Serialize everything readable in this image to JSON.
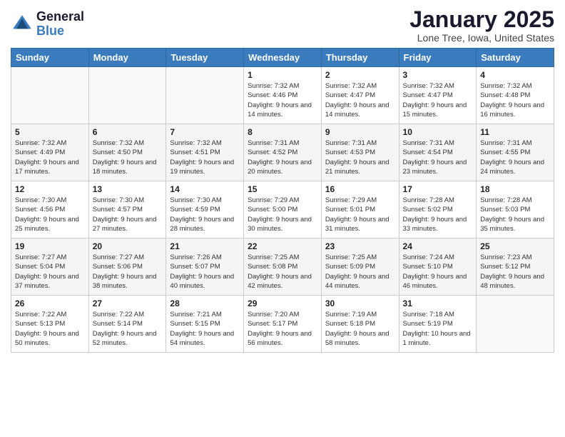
{
  "header": {
    "logo_general": "General",
    "logo_blue": "Blue",
    "month_title": "January 2025",
    "location": "Lone Tree, Iowa, United States"
  },
  "days_of_week": [
    "Sunday",
    "Monday",
    "Tuesday",
    "Wednesday",
    "Thursday",
    "Friday",
    "Saturday"
  ],
  "weeks": [
    [
      {
        "day": "",
        "sunrise": "",
        "sunset": "",
        "daylight": ""
      },
      {
        "day": "",
        "sunrise": "",
        "sunset": "",
        "daylight": ""
      },
      {
        "day": "",
        "sunrise": "",
        "sunset": "",
        "daylight": ""
      },
      {
        "day": "1",
        "sunrise": "Sunrise: 7:32 AM",
        "sunset": "Sunset: 4:46 PM",
        "daylight": "Daylight: 9 hours and 14 minutes."
      },
      {
        "day": "2",
        "sunrise": "Sunrise: 7:32 AM",
        "sunset": "Sunset: 4:47 PM",
        "daylight": "Daylight: 9 hours and 14 minutes."
      },
      {
        "day": "3",
        "sunrise": "Sunrise: 7:32 AM",
        "sunset": "Sunset: 4:47 PM",
        "daylight": "Daylight: 9 hours and 15 minutes."
      },
      {
        "day": "4",
        "sunrise": "Sunrise: 7:32 AM",
        "sunset": "Sunset: 4:48 PM",
        "daylight": "Daylight: 9 hours and 16 minutes."
      }
    ],
    [
      {
        "day": "5",
        "sunrise": "Sunrise: 7:32 AM",
        "sunset": "Sunset: 4:49 PM",
        "daylight": "Daylight: 9 hours and 17 minutes."
      },
      {
        "day": "6",
        "sunrise": "Sunrise: 7:32 AM",
        "sunset": "Sunset: 4:50 PM",
        "daylight": "Daylight: 9 hours and 18 minutes."
      },
      {
        "day": "7",
        "sunrise": "Sunrise: 7:32 AM",
        "sunset": "Sunset: 4:51 PM",
        "daylight": "Daylight: 9 hours and 19 minutes."
      },
      {
        "day": "8",
        "sunrise": "Sunrise: 7:31 AM",
        "sunset": "Sunset: 4:52 PM",
        "daylight": "Daylight: 9 hours and 20 minutes."
      },
      {
        "day": "9",
        "sunrise": "Sunrise: 7:31 AM",
        "sunset": "Sunset: 4:53 PM",
        "daylight": "Daylight: 9 hours and 21 minutes."
      },
      {
        "day": "10",
        "sunrise": "Sunrise: 7:31 AM",
        "sunset": "Sunset: 4:54 PM",
        "daylight": "Daylight: 9 hours and 23 minutes."
      },
      {
        "day": "11",
        "sunrise": "Sunrise: 7:31 AM",
        "sunset": "Sunset: 4:55 PM",
        "daylight": "Daylight: 9 hours and 24 minutes."
      }
    ],
    [
      {
        "day": "12",
        "sunrise": "Sunrise: 7:30 AM",
        "sunset": "Sunset: 4:56 PM",
        "daylight": "Daylight: 9 hours and 25 minutes."
      },
      {
        "day": "13",
        "sunrise": "Sunrise: 7:30 AM",
        "sunset": "Sunset: 4:57 PM",
        "daylight": "Daylight: 9 hours and 27 minutes."
      },
      {
        "day": "14",
        "sunrise": "Sunrise: 7:30 AM",
        "sunset": "Sunset: 4:59 PM",
        "daylight": "Daylight: 9 hours and 28 minutes."
      },
      {
        "day": "15",
        "sunrise": "Sunrise: 7:29 AM",
        "sunset": "Sunset: 5:00 PM",
        "daylight": "Daylight: 9 hours and 30 minutes."
      },
      {
        "day": "16",
        "sunrise": "Sunrise: 7:29 AM",
        "sunset": "Sunset: 5:01 PM",
        "daylight": "Daylight: 9 hours and 31 minutes."
      },
      {
        "day": "17",
        "sunrise": "Sunrise: 7:28 AM",
        "sunset": "Sunset: 5:02 PM",
        "daylight": "Daylight: 9 hours and 33 minutes."
      },
      {
        "day": "18",
        "sunrise": "Sunrise: 7:28 AM",
        "sunset": "Sunset: 5:03 PM",
        "daylight": "Daylight: 9 hours and 35 minutes."
      }
    ],
    [
      {
        "day": "19",
        "sunrise": "Sunrise: 7:27 AM",
        "sunset": "Sunset: 5:04 PM",
        "daylight": "Daylight: 9 hours and 37 minutes."
      },
      {
        "day": "20",
        "sunrise": "Sunrise: 7:27 AM",
        "sunset": "Sunset: 5:06 PM",
        "daylight": "Daylight: 9 hours and 38 minutes."
      },
      {
        "day": "21",
        "sunrise": "Sunrise: 7:26 AM",
        "sunset": "Sunset: 5:07 PM",
        "daylight": "Daylight: 9 hours and 40 minutes."
      },
      {
        "day": "22",
        "sunrise": "Sunrise: 7:25 AM",
        "sunset": "Sunset: 5:08 PM",
        "daylight": "Daylight: 9 hours and 42 minutes."
      },
      {
        "day": "23",
        "sunrise": "Sunrise: 7:25 AM",
        "sunset": "Sunset: 5:09 PM",
        "daylight": "Daylight: 9 hours and 44 minutes."
      },
      {
        "day": "24",
        "sunrise": "Sunrise: 7:24 AM",
        "sunset": "Sunset: 5:10 PM",
        "daylight": "Daylight: 9 hours and 46 minutes."
      },
      {
        "day": "25",
        "sunrise": "Sunrise: 7:23 AM",
        "sunset": "Sunset: 5:12 PM",
        "daylight": "Daylight: 9 hours and 48 minutes."
      }
    ],
    [
      {
        "day": "26",
        "sunrise": "Sunrise: 7:22 AM",
        "sunset": "Sunset: 5:13 PM",
        "daylight": "Daylight: 9 hours and 50 minutes."
      },
      {
        "day": "27",
        "sunrise": "Sunrise: 7:22 AM",
        "sunset": "Sunset: 5:14 PM",
        "daylight": "Daylight: 9 hours and 52 minutes."
      },
      {
        "day": "28",
        "sunrise": "Sunrise: 7:21 AM",
        "sunset": "Sunset: 5:15 PM",
        "daylight": "Daylight: 9 hours and 54 minutes."
      },
      {
        "day": "29",
        "sunrise": "Sunrise: 7:20 AM",
        "sunset": "Sunset: 5:17 PM",
        "daylight": "Daylight: 9 hours and 56 minutes."
      },
      {
        "day": "30",
        "sunrise": "Sunrise: 7:19 AM",
        "sunset": "Sunset: 5:18 PM",
        "daylight": "Daylight: 9 hours and 58 minutes."
      },
      {
        "day": "31",
        "sunrise": "Sunrise: 7:18 AM",
        "sunset": "Sunset: 5:19 PM",
        "daylight": "Daylight: 10 hours and 1 minute."
      },
      {
        "day": "",
        "sunrise": "",
        "sunset": "",
        "daylight": ""
      }
    ]
  ]
}
